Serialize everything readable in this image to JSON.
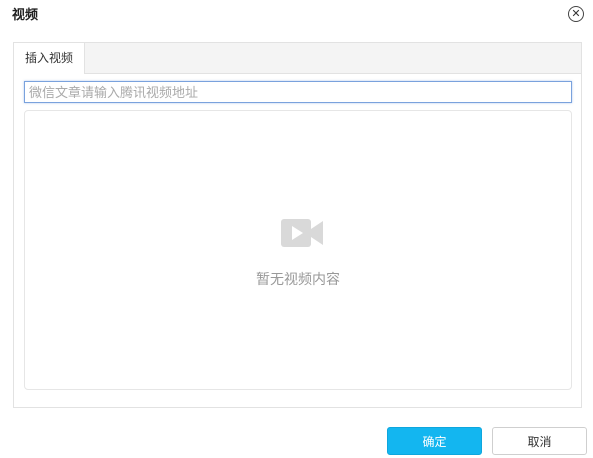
{
  "dialog": {
    "title": "视频",
    "close_icon": "close-icon"
  },
  "tabs": [
    {
      "label": "插入视频",
      "active": true
    }
  ],
  "url_input": {
    "value": "",
    "placeholder": "微信文章请输入腾讯视频地址"
  },
  "preview": {
    "icon": "video-camera-icon",
    "empty_text": "暂无视频内容"
  },
  "buttons": {
    "ok_label": "确定",
    "cancel_label": "取消"
  },
  "colors": {
    "accent": "#13b6f0",
    "input_focus_border": "#7aa2dd",
    "icon_gray": "#d9d9d9"
  }
}
